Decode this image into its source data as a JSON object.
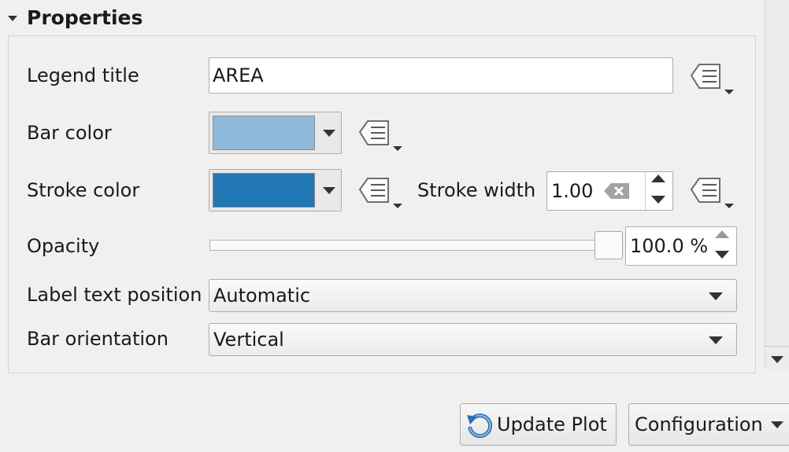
{
  "section": {
    "title": "Properties"
  },
  "fields": {
    "legend_title": {
      "label": "Legend title",
      "value": "AREA"
    },
    "bar_color": {
      "label": "Bar color",
      "color": "#8fb9da"
    },
    "stroke_color": {
      "label": "Stroke color",
      "color": "#2277b5"
    },
    "stroke_width": {
      "label": "Stroke width",
      "value": "1.00"
    },
    "opacity": {
      "label": "Opacity",
      "value": "100.0 %",
      "level": 1.0
    },
    "label_text_position": {
      "label": "Label text position",
      "selected": "Automatic"
    },
    "bar_orientation": {
      "label": "Bar orientation",
      "selected": "Vertical"
    }
  },
  "footer": {
    "update_plot": "Update Plot",
    "configuration": "Configuration"
  },
  "icons": {
    "data_defined": "data-defined-override-icon",
    "refresh": "refresh-icon",
    "clear": "clear-icon"
  }
}
